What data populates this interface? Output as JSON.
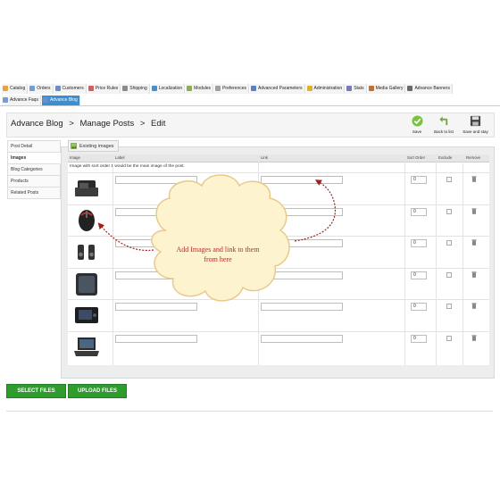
{
  "menu": {
    "row1": [
      "Catalog",
      "Orders",
      "Customers",
      "Price Rules",
      "Shipping",
      "Localization",
      "Modules",
      "Preferences",
      "Advanced Parameters",
      "Administration",
      "Stats",
      "Media Gallery",
      "Advance Banners"
    ],
    "row2": [
      "Advance Faqs",
      "Advance Blog"
    ]
  },
  "breadcrumb": {
    "part1": "Advance Blog",
    "sep": ">",
    "part2": "Manage Posts",
    "part3": "Edit"
  },
  "toolbar": {
    "save": "Save",
    "back": "Back to list",
    "save_stay": "Save and stay"
  },
  "sidetabs": [
    "Post Detail",
    "Images",
    "Blog Categories",
    "Products",
    "Related Posts"
  ],
  "fieldset_title": "Existing images",
  "table": {
    "headers": {
      "image": "Image",
      "label": "Label",
      "link": "Link",
      "sort": "Sort Order",
      "exclude": "Exclude",
      "remove": "Remove"
    },
    "notice": "Image with sort order 1 would be the main image of the post.",
    "rows": [
      {
        "sort": "0",
        "thumb": "laptop-box-image"
      },
      {
        "sort": "0",
        "thumb": "gaming-mouse-image"
      },
      {
        "sort": "0",
        "thumb": "speakers-image"
      },
      {
        "sort": "0",
        "thumb": "media-box-image"
      },
      {
        "sort": "0",
        "thumb": "portable-dvd-image"
      },
      {
        "sort": "0",
        "thumb": "laptop-image"
      }
    ]
  },
  "callout": {
    "text": "Add Images and link to them from here"
  },
  "buttons": {
    "select": "SELECT FILES",
    "upload": "UPLOAD FILES"
  },
  "colors": {
    "active_tab": "#3b8fd1",
    "button_green": "#2e9d2e",
    "callout_fill": "#fdf3cf",
    "callout_text": "#b03028"
  }
}
